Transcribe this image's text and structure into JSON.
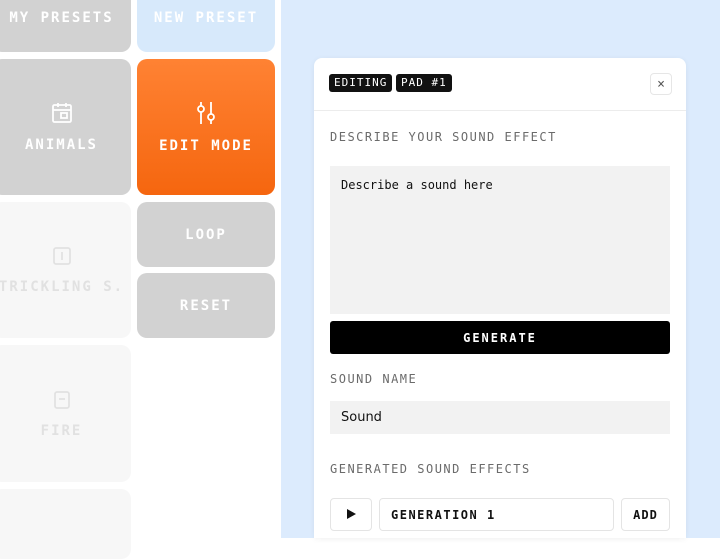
{
  "pads": {
    "my_presets": "MY PRESETS",
    "new_preset": "NEW PRESET",
    "animals": "ANIMALS",
    "edit_mode": "EDIT MODE",
    "trickling": "TRICKLING S.",
    "loop": "LOOP",
    "fire": "FIRE",
    "reset": "RESET"
  },
  "icons": {
    "animals": "calendar-icon",
    "edit_mode": "sliders-icon",
    "trickling": "numbered-pad-icon",
    "fire": "flame-icon"
  },
  "editor": {
    "tag_editing": "EDITING",
    "tag_pad": "PAD #1",
    "close_glyph": "×",
    "describe_label": "DESCRIBE YOUR SOUND EFFECT",
    "describe_placeholder": "Describe a sound here",
    "generate_button": "GENERATE",
    "sound_name_label": "SOUND NAME",
    "sound_name_value": "Sound",
    "generated_label": "GENERATED SOUND EFFECTS",
    "generations": [
      {
        "label": "GENERATION 1",
        "add_label": "ADD"
      }
    ]
  },
  "colors": {
    "accent": "#f97316",
    "pane_background": "#dcebfd",
    "primary_button": "#000000"
  }
}
